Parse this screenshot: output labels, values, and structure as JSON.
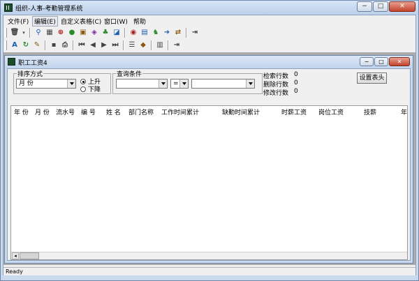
{
  "window": {
    "title": "组织-人事-考勤管理系统"
  },
  "window_controls": {
    "minimize": "−",
    "maximize": "□",
    "close": "✕"
  },
  "menu": [
    {
      "label": "文件(F)",
      "active": false
    },
    {
      "label": "编辑(E)",
      "active": true
    },
    {
      "label": "自定义表格(C)",
      "active": false
    },
    {
      "label": "窗口(W)",
      "active": false
    },
    {
      "label": "帮助",
      "active": false
    }
  ],
  "toolbar1_icons": [
    "trash-icon",
    "search-person-icon",
    "grid-icon",
    "target-icon",
    "globe-icon",
    "person-card-icon",
    "folder-icon",
    "user-icon",
    "chart-icon",
    "shield-icon",
    "lock-icon",
    "person-run-icon",
    "arrow-right-icon",
    "exit-icon"
  ],
  "toolbar2_icons": [
    "font-icon",
    "refresh-icon",
    "edit-icon",
    "save-icon",
    "print-icon",
    "first-icon",
    "prev-icon",
    "next-icon",
    "last-icon",
    "sort-icon",
    "tag-icon",
    "table-icon",
    "door-icon"
  ],
  "child": {
    "title": "职工工资4"
  },
  "sort": {
    "legend": "排序方式",
    "field_value": "月 份",
    "ascending_label": "上升",
    "descending_label": "下降",
    "selected": "ascending"
  },
  "query": {
    "legend": "查询条件",
    "field_value": "",
    "operator_value": "=",
    "value": ""
  },
  "stats": {
    "retrieved_label": "检索行数",
    "retrieved_value": "0",
    "deleted_label": "删除行数",
    "deleted_value": "0",
    "modified_label": "修改行数",
    "modified_value": "0"
  },
  "set_header_button": "设置表头",
  "grid": {
    "columns": [
      "年 份",
      "月 份",
      "流水号",
      "编 号",
      "姓 名",
      "部门名称",
      "工作时间累计",
      "缺勤时间累计",
      "时薪工资",
      "岗位工资",
      "技薪",
      "年"
    ]
  },
  "status": {
    "text": "Ready"
  }
}
